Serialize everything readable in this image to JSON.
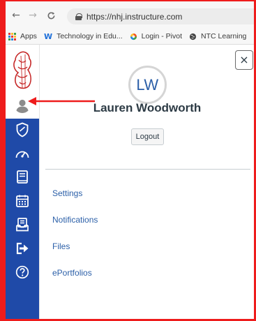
{
  "browser": {
    "url": "https://nhj.instructure.com",
    "bookmarks": [
      {
        "label": "Apps",
        "icon": "apps-grid-icon"
      },
      {
        "label": "Technology in Edu...",
        "icon": "w-logo-icon"
      },
      {
        "label": "Login - Pivot",
        "icon": "pivot-logo-icon"
      },
      {
        "label": "NTC Learning",
        "icon": "globe-icon"
      }
    ]
  },
  "sidebar": {
    "items": [
      {
        "name": "account",
        "icon": "user-silhouette-icon"
      },
      {
        "name": "admin",
        "icon": "shield-icon"
      },
      {
        "name": "dashboard",
        "icon": "gauge-icon"
      },
      {
        "name": "courses",
        "icon": "book-icon"
      },
      {
        "name": "calendar",
        "icon": "calendar-icon"
      },
      {
        "name": "inbox",
        "icon": "inbox-icon"
      },
      {
        "name": "commons",
        "icon": "arrow-exit-icon"
      },
      {
        "name": "help",
        "icon": "question-circle-icon"
      }
    ]
  },
  "tray": {
    "initials": "LW",
    "name": "Lauren Woodworth",
    "logout_label": "Logout",
    "links": [
      {
        "label": "Settings"
      },
      {
        "label": "Notifications"
      },
      {
        "label": "Files"
      },
      {
        "label": "ePortfolios"
      }
    ],
    "close_label": "×"
  },
  "colors": {
    "sidebar": "#1f4aa8",
    "frame": "#ee1c1c",
    "link": "#2b5fa8",
    "name": "#2d3b45"
  }
}
